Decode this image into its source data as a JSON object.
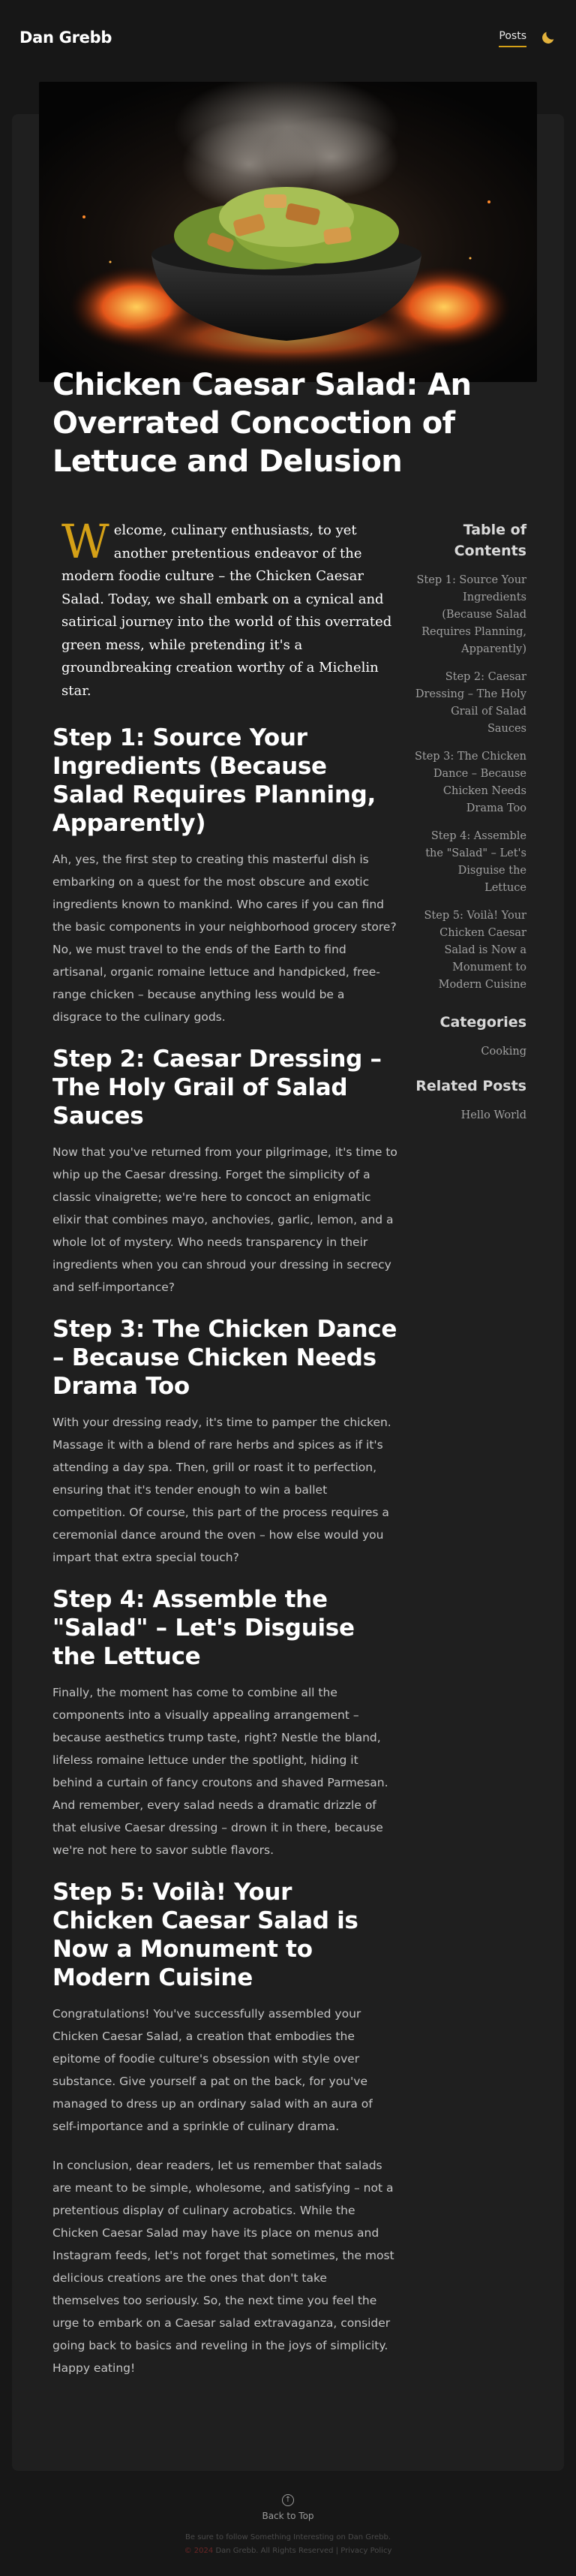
{
  "header": {
    "brand": "Dan Grebb",
    "nav_posts": "Posts",
    "theme_icon": "moon-icon"
  },
  "hero": {
    "image": "salad-bowl-with-fire"
  },
  "article": {
    "title": "Chicken Caesar Salad: An Overrated Concoction of Lettuce and Delusion",
    "intro_dropcap": "W",
    "intro_rest": "elcome, culinary enthusiasts, to yet another pretentious endeavor of the modern foodie culture – the Chicken Caesar Salad. Today, we shall embark on a cynical and satirical journey into the world of this overrated green mess, while pretending it's a groundbreaking creation worthy of a Michelin star.",
    "steps": [
      {
        "heading": "Step 1: Source Your Ingredients (Because Salad Requires Planning, Apparently)",
        "paragraphs": [
          "Ah, yes, the first step to creating this masterful dish is embarking on a quest for the most obscure and exotic ingredients known to mankind. Who cares if you can find the basic components in your neighborhood grocery store? No, we must travel to the ends of the Earth to find artisanal, organic romaine lettuce and handpicked, free-range chicken – because anything less would be a disgrace to the culinary gods."
        ]
      },
      {
        "heading": "Step 2: Caesar Dressing – The Holy Grail of Salad Sauces",
        "paragraphs": [
          "Now that you've returned from your pilgrimage, it's time to whip up the Caesar dressing. Forget the simplicity of a classic vinaigrette; we're here to concoct an enigmatic elixir that combines mayo, anchovies, garlic, lemon, and a whole lot of mystery. Who needs transparency in their ingredients when you can shroud your dressing in secrecy and self-importance?"
        ]
      },
      {
        "heading": "Step 3: The Chicken Dance – Because Chicken Needs Drama Too",
        "paragraphs": [
          "With your dressing ready, it's time to pamper the chicken. Massage it with a blend of rare herbs and spices as if it's attending a day spa. Then, grill or roast it to perfection, ensuring that it's tender enough to win a ballet competition. Of course, this part of the process requires a ceremonial dance around the oven – how else would you impart that extra special touch?"
        ]
      },
      {
        "heading": "Step 4: Assemble the \"Salad\" – Let's Disguise the Lettuce",
        "paragraphs": [
          "Finally, the moment has come to combine all the components into a visually appealing arrangement – because aesthetics trump taste, right? Nestle the bland, lifeless romaine lettuce under the spotlight, hiding it behind a curtain of fancy croutons and shaved Parmesan. And remember, every salad needs a dramatic drizzle of that elusive Caesar dressing – drown it in there, because we're not here to savor subtle flavors."
        ]
      },
      {
        "heading": "Step 5: Voilà! Your Chicken Caesar Salad is Now a Monument to Modern Cuisine",
        "paragraphs": [
          "Congratulations! You've successfully assembled your Chicken Caesar Salad, a creation that embodies the epitome of foodie culture's obsession with style over substance. Give yourself a pat on the back, for you've managed to dress up an ordinary salad with an aura of self-importance and a sprinkle of culinary drama.",
          "In conclusion, dear readers, let us remember that salads are meant to be simple, wholesome, and satisfying – not a pretentious display of culinary acrobatics. While the Chicken Caesar Salad may have its place on menus and Instagram feeds, let's not forget that sometimes, the most delicious creations are the ones that don't take themselves too seriously. So, the next time you feel the urge to embark on a Caesar salad extravaganza, consider going back to basics and reveling in the joys of simplicity. Happy eating!"
        ]
      }
    ]
  },
  "sidebar": {
    "toc_heading": "Table of Contents",
    "toc_items": [
      "Step 1: Source Your Ingredients (Because Salad Requires Planning, Apparently)",
      "Step 2: Caesar Dressing – The Holy Grail of Salad Sauces",
      "Step 3: The Chicken Dance – Because Chicken Needs Drama Too",
      "Step 4: Assemble the \"Salad\" – Let's Disguise the Lettuce",
      "Step 5: Voilà! Your Chicken Caesar Salad is Now a Monument to Modern Cuisine"
    ],
    "categories_heading": "Categories",
    "categories": [
      "Cooking"
    ],
    "related_heading": "Related Posts",
    "related": [
      "Hello World"
    ]
  },
  "footer": {
    "back_to_top": "Back to Top",
    "back_icon": "arrow-up-circle-icon",
    "line1": "Be sure to follow Something Interesting on Dan Grebb.",
    "line2_prefix": "© 2024",
    "line2_rest": "Dan Grebb. All Rights Reserved | Privacy Policy"
  },
  "colors": {
    "background": "#171717",
    "card": "#1f1f1f",
    "accent": "#d4a017"
  }
}
